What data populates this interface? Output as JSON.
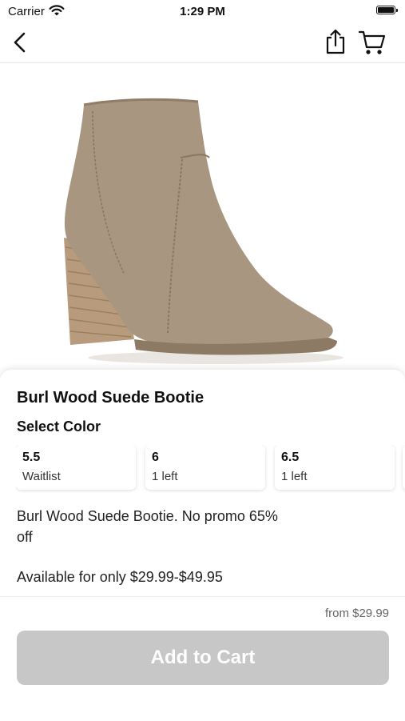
{
  "status_bar": {
    "carrier": "Carrier",
    "time": "1:29 PM"
  },
  "nav": {
    "back_icon": "chevron-left-icon",
    "share_icon": "share-icon",
    "cart_icon": "cart-icon"
  },
  "product": {
    "image": "ankle-bootie-image",
    "title": "Burl Wood Suede Bootie",
    "select_color_label": "Select Color",
    "sizes": [
      {
        "size": "5.5",
        "status": "Waitlist"
      },
      {
        "size": "6",
        "status": "1 left"
      },
      {
        "size": "6.5",
        "status": "1 left"
      }
    ],
    "description": "Burl Wood Suede Bootie. No promo 65% off",
    "availability": "Available for only $29.99-$49.95",
    "from_price": "from $29.99",
    "add_to_cart_label": "Add to Cart"
  },
  "colors": {
    "button_disabled": "#c7c7c7",
    "suede": "#a89680",
    "heel_wood": "#b89a7c"
  }
}
